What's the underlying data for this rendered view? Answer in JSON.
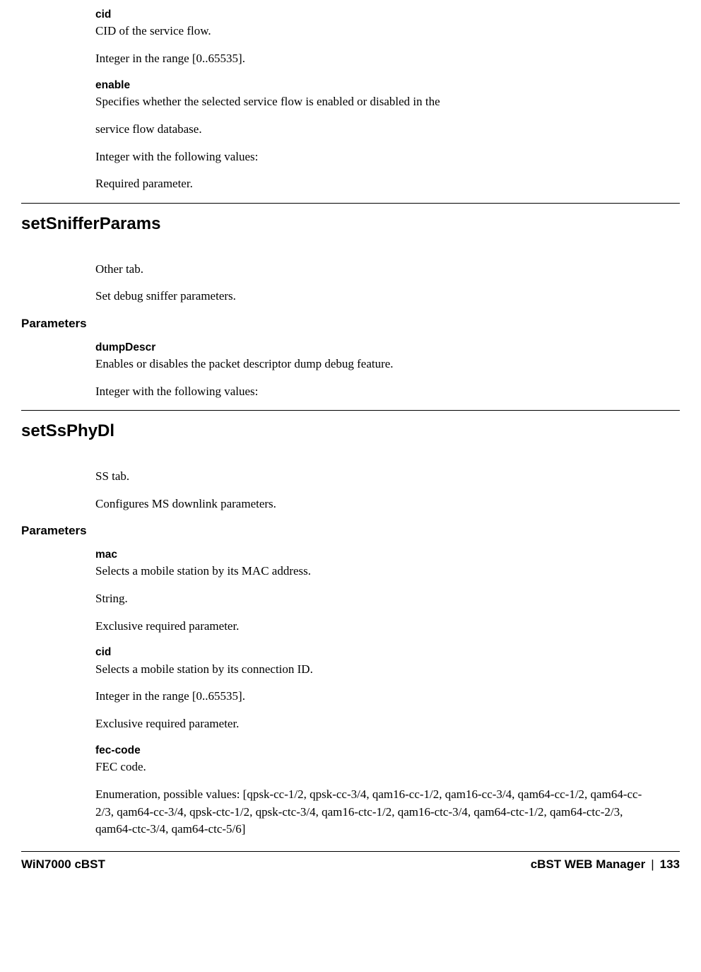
{
  "intro": {
    "cid": {
      "name": "cid",
      "desc": "CID of the service flow.",
      "range": "Integer in the range [0..65535]."
    },
    "enable": {
      "name": "enable",
      "desc1": "Specifies whether the selected service flow is enabled or disabled in the",
      "desc2": "service flow database.",
      "values": "Integer with the following values:",
      "req": "Required parameter."
    }
  },
  "sniffer": {
    "heading": "setSnifferParams",
    "tab": "Other tab.",
    "desc": "Set debug sniffer parameters.",
    "params_label": "Parameters",
    "dumpDescr": {
      "name": "dumpDescr",
      "desc": "Enables or disables the packet descriptor dump debug feature.",
      "values": "Integer with the following values:"
    }
  },
  "ssphy": {
    "heading": "setSsPhyDl",
    "tab": "SS tab.",
    "desc": "Configures MS downlink parameters.",
    "params_label": "Parameters",
    "mac": {
      "name": "mac",
      "desc": "Selects a mobile station by its MAC address.",
      "type": "String.",
      "req": "Exclusive required parameter."
    },
    "cid": {
      "name": "cid",
      "desc": "Selects a mobile station by its connection ID.",
      "range": "Integer in the range [0..65535].",
      "req": "Exclusive required parameter."
    },
    "fec": {
      "name": "fec-code",
      "desc": "FEC code.",
      "enum": "Enumeration, possible values: [qpsk-cc-1/2, qpsk-cc-3/4, qam16-cc-1/2, qam16-cc-3/4, qam64-cc-1/2, qam64-cc-2/3, qam64-cc-3/4, qpsk-ctc-1/2, qpsk-ctc-3/4, qam16-ctc-1/2, qam16-ctc-3/4, qam64-ctc-1/2, qam64-ctc-2/3, qam64-ctc-3/4, qam64-ctc-5/6]"
    }
  },
  "footer": {
    "left": "WiN7000 cBST",
    "right_title": "cBST WEB Manager",
    "sep": "|",
    "page": "133"
  }
}
